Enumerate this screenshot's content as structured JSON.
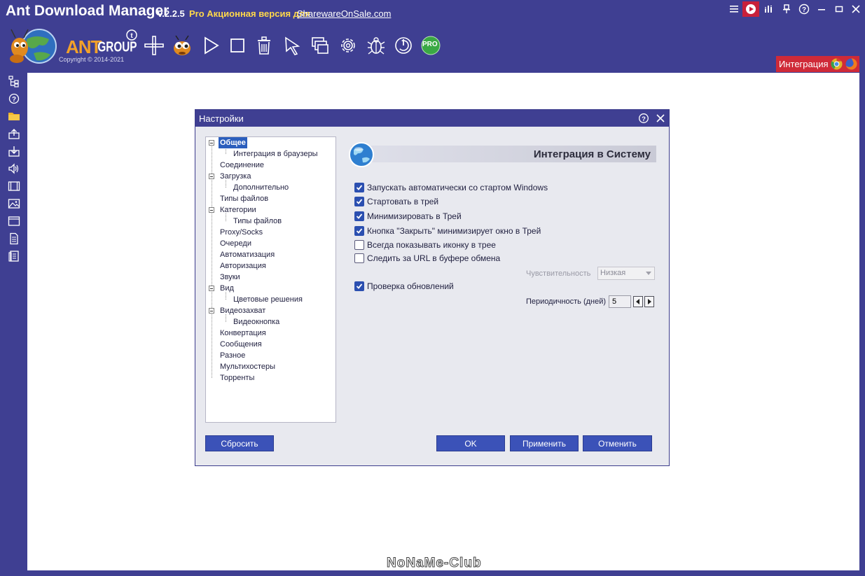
{
  "app": {
    "title": "Ant Download Manager",
    "version": "v.2.2.5",
    "promo_text": "Pro Акционная версия для",
    "promo_link": "SharewareOnSale.com",
    "logo_text": "ANT GROUP",
    "copyright": "Copyright © 2014-2021",
    "accent_color": "#3f3f92"
  },
  "window_controls": [
    "menu-icon",
    "play-record-icon",
    "levels-icon",
    "pin-icon",
    "help-icon",
    "minimize-icon",
    "maximize-icon",
    "close-icon"
  ],
  "toolbar": {
    "items": [
      "add-icon",
      "ant-mascot-icon",
      "play-icon",
      "stop-icon",
      "trash-icon",
      "pointer-icon",
      "windows-icon",
      "gear-icon",
      "bug-icon",
      "power-icon",
      "pro-badge-icon"
    ],
    "pro_label": "PRO"
  },
  "integration_button": {
    "label": "Интеграция",
    "color": "#cf2a38"
  },
  "sidebar_icons": [
    "tree-icon",
    "help-icon",
    "folder-icon",
    "upload-icon",
    "download-icon",
    "audio-icon",
    "film-icon",
    "image-icon",
    "window-icon",
    "document-icon",
    "archive-icon"
  ],
  "dialog": {
    "title": "Настройки",
    "tree": [
      {
        "label": "Общее",
        "level": 0,
        "selected": true,
        "expander": true
      },
      {
        "label": "Интеграция в браузеры",
        "level": 1
      },
      {
        "label": "Соединение",
        "level": 0
      },
      {
        "label": "Загрузка",
        "level": 0,
        "expander": true
      },
      {
        "label": "Дополнительно",
        "level": 1
      },
      {
        "label": "Типы файлов",
        "level": 0
      },
      {
        "label": "Категории",
        "level": 0,
        "expander": true
      },
      {
        "label": "Типы файлов",
        "level": 1
      },
      {
        "label": "Proxy/Socks",
        "level": 0
      },
      {
        "label": "Очереди",
        "level": 0
      },
      {
        "label": "Автоматизация",
        "level": 0
      },
      {
        "label": "Авторизация",
        "level": 0
      },
      {
        "label": "Звуки",
        "level": 0
      },
      {
        "label": "Вид",
        "level": 0,
        "expander": true
      },
      {
        "label": "Цветовые решения",
        "level": 1
      },
      {
        "label": "Видеозахват",
        "level": 0,
        "expander": true
      },
      {
        "label": "Видеокнопка",
        "level": 1
      },
      {
        "label": "Конвертация",
        "level": 0
      },
      {
        "label": "Сообщения",
        "level": 0
      },
      {
        "label": "Разное",
        "level": 0
      },
      {
        "label": "Мультихостеры",
        "level": 0
      },
      {
        "label": "Торренты",
        "level": 0
      }
    ],
    "section_title": "Интеграция в Систему",
    "options": [
      {
        "label": "Запускать автоматически со стартом Windows",
        "checked": true
      },
      {
        "label": "Стартовать в трей",
        "checked": true
      },
      {
        "label": "Минимизировать в Трей",
        "checked": true
      },
      {
        "label": "Кнопка \"Закрыть\" минимизирует окно в Трей",
        "checked": true
      },
      {
        "label": "Всегда показывать иконку в трее",
        "checked": false
      },
      {
        "label": "Следить за URL в буфере обмена",
        "checked": false
      },
      {
        "label": "Проверка обновлений",
        "checked": true
      }
    ],
    "sensitivity_label": "Чувствительность",
    "sensitivity_value": "Низкая",
    "period_label": "Периодичность (дней)",
    "period_value": "5",
    "buttons": {
      "reset": "Сбросить",
      "ok": "OK",
      "apply": "Применить",
      "cancel": "Отменить"
    }
  },
  "watermark": "NoNaMe-Club"
}
